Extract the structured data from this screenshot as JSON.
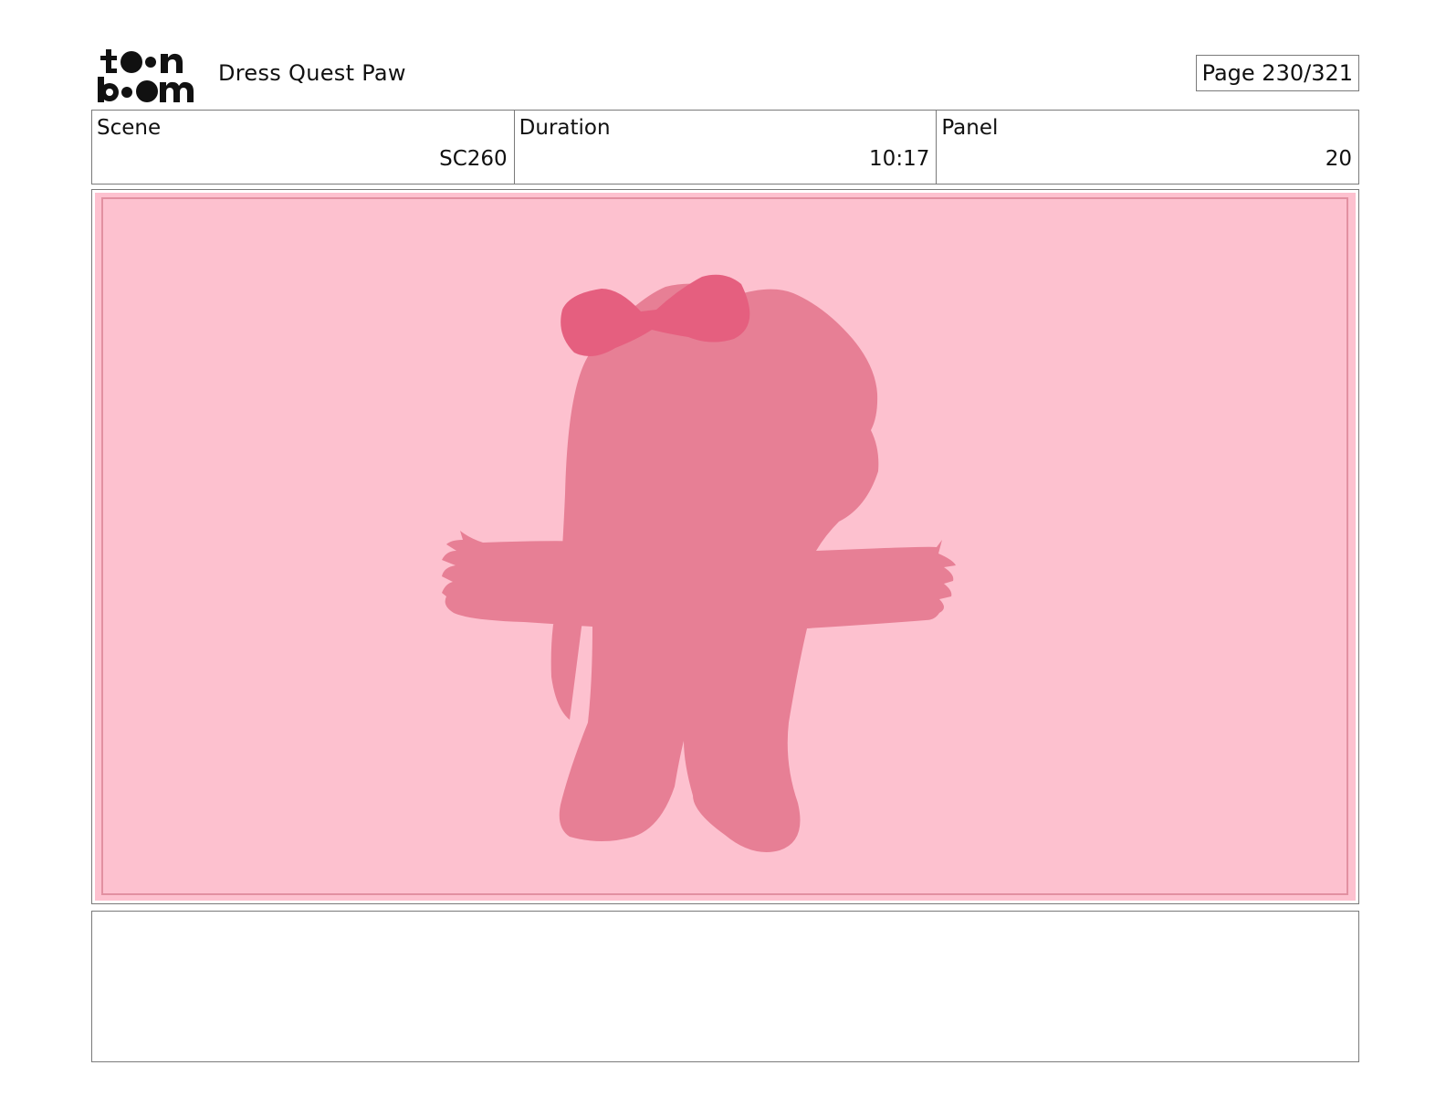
{
  "header": {
    "logo_top": "toon",
    "logo_bottom": "boom",
    "project_title": "Dress Quest Paw",
    "page_counter": "Page 230/321"
  },
  "info": {
    "scene_label": "Scene",
    "scene_value": "SC260",
    "duration_label": "Duration",
    "duration_value": "10:17",
    "panel_label": "Panel",
    "panel_value": "20"
  },
  "panel": {
    "background_color": "#fdc1cf",
    "figure_color": "#e77f95",
    "bow_color": "#e55f7f"
  },
  "notes": {
    "text": ""
  }
}
